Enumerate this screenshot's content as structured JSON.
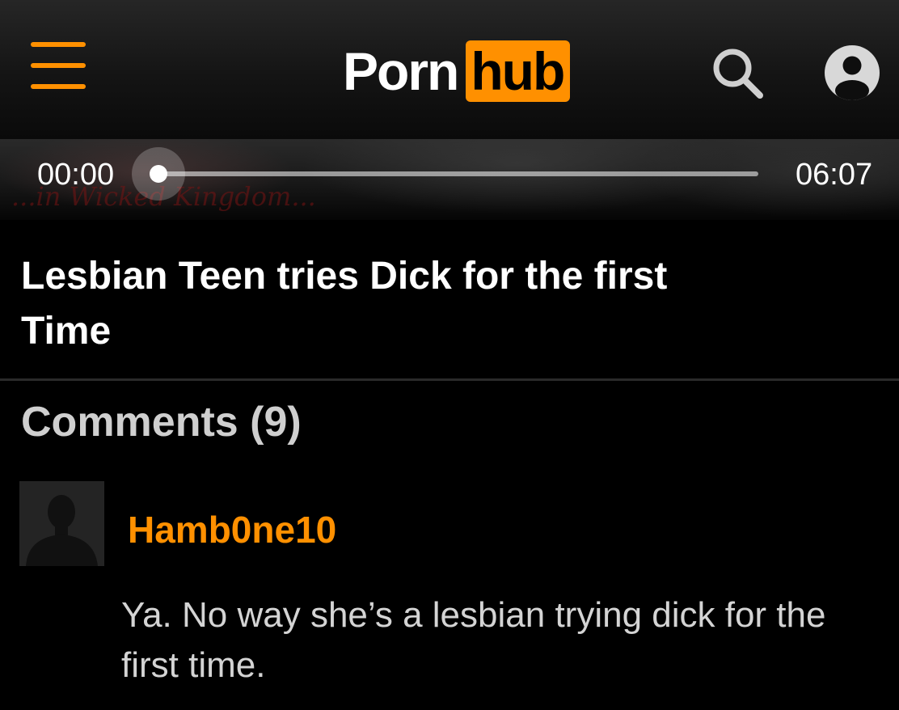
{
  "header": {
    "menu_icon": "hamburger-menu-icon",
    "logo": {
      "part1": "Porn",
      "part2": "hub"
    },
    "search_icon": "search-icon",
    "account_icon": "user-account-icon"
  },
  "player": {
    "current_time": "00:00",
    "total_time": "06:07",
    "progress": 0,
    "overlay_text": "...in Wicked Kingdom..."
  },
  "video": {
    "title": "Lesbian Teen tries Dick for the first Time"
  },
  "comments": {
    "heading": "Comments (9)",
    "items": [
      {
        "username": "Hamb0ne10",
        "avatar_icon": "default-avatar-silhouette-icon",
        "text": "Ya. No way she’s a lesbian trying dick for the first time."
      }
    ]
  },
  "colors": {
    "accent": "#ff9000",
    "background": "#000000",
    "text": "#ffffff",
    "muted_text": "#d4d4d4"
  }
}
